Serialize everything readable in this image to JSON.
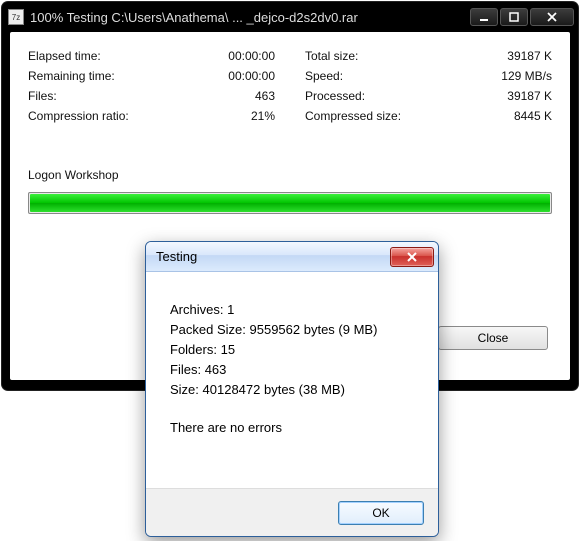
{
  "main": {
    "app_icon_text": "7z",
    "title": "100% Testing C:\\Users\\Anathema\\ ... _dejco-d2s2dv0.rar",
    "stats_left": [
      {
        "label": "Elapsed time:",
        "value": "00:00:00"
      },
      {
        "label": "Remaining time:",
        "value": "00:00:00"
      },
      {
        "label": "Files:",
        "value": "463"
      },
      {
        "label": "Compression ratio:",
        "value": "21%"
      }
    ],
    "stats_right": [
      {
        "label": "Total size:",
        "value": "39187 K"
      },
      {
        "label": "Speed:",
        "value": "129 MB/s"
      },
      {
        "label": "Processed:",
        "value": "39187 K"
      },
      {
        "label": "Compressed size:",
        "value": "8445 K"
      }
    ],
    "current_item": "Logon Workshop",
    "progress_percent": 100,
    "close_label": "Close"
  },
  "dialog": {
    "title": "Testing",
    "lines": {
      "archives_label": "Archives:",
      "archives_value": "1",
      "packed_label": "Packed Size:",
      "packed_value": "9559562 bytes (9 MB)",
      "folders_label": "Folders:",
      "folders_value": "15",
      "files_label": "Files:",
      "files_value": "463",
      "size_label": "Size:",
      "size_value": "40128472 bytes (38 MB)",
      "status": "There are no errors"
    },
    "ok_label": "OK"
  }
}
